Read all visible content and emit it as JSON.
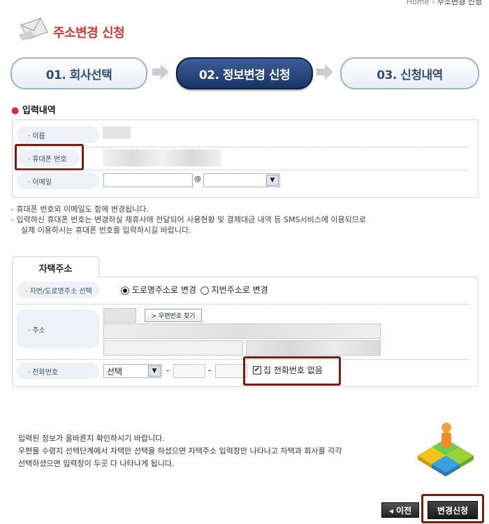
{
  "breadcrumb": {
    "home": "Home",
    "sep": "›",
    "current": "주소변경 신청"
  },
  "page": {
    "title": "주소변경 신청"
  },
  "steps": [
    {
      "label": "01. 회사선택",
      "active": false
    },
    {
      "label": "02. 정보변경 신청",
      "active": true
    },
    {
      "label": "03. 신청내역",
      "active": false
    }
  ],
  "input_section": {
    "title": "입력내역",
    "name_label": "· 이름",
    "phone_label": "· 휴대폰 번호",
    "email_label": "· 이메일",
    "email_at": "@",
    "email_domain_value": "",
    "notes": [
      "- 휴대폰 번호외 이메일도 함께 변경됩니다.",
      "- 입력하신 휴대폰 번호는 변경하실 제휴사에 전달되어 사용현황 및 결제대금 내역 등 SMS서비스에 이용되므로",
      "실제 이용하시는 휴대폰 번호를 입력하시길 바랍니다."
    ]
  },
  "home_address": {
    "tab_label": "자택주소",
    "type_label": "· 지번/도로명주소 선택",
    "option_road": "도로명주소로 변경",
    "option_lot": "지번주소로 변경",
    "selected": "road",
    "address_label": "· 주소",
    "zip_button": "> 우편번호 찾기",
    "phone_label": "· 전화번호",
    "phone_select": "선택",
    "phone_dash1": "-",
    "phone_dash2": "-",
    "no_phone_label": "집 전화번호 없음",
    "no_phone_checked": true
  },
  "footer": {
    "lines": [
      "입력된 정보가 올바른지 확인하시기 바랍니다.",
      "우편물 수령지 선택단계에서 자택만 선택을 하셨으면 자택주소 입력창만 나타나고 자택과 회사를 각각",
      "선택하셨으면 입력창이 두곳 다 나타나게 됩니다."
    ],
    "prev_button": "◂ 이전",
    "submit_button": "변경신청"
  },
  "colors": {
    "accent": "#d6322e",
    "step_active": "#183465",
    "highlight": "#7a1d10"
  }
}
